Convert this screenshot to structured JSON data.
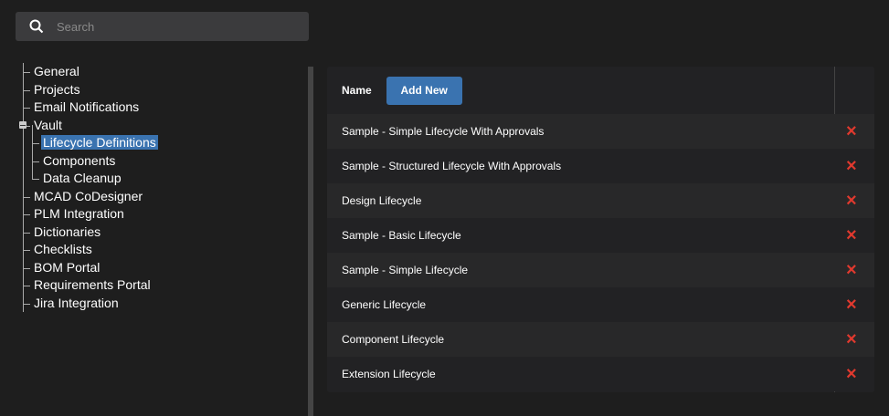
{
  "search": {
    "placeholder": "Search"
  },
  "tree": {
    "items": [
      {
        "label": "General",
        "level": 0
      },
      {
        "label": "Projects",
        "level": 0
      },
      {
        "label": "Email Notifications",
        "level": 0
      },
      {
        "label": "Vault",
        "level": 0,
        "expanded": true
      },
      {
        "label": "Lifecycle Definitions",
        "level": 1,
        "selected": true
      },
      {
        "label": "Components",
        "level": 1
      },
      {
        "label": "Data Cleanup",
        "level": 1
      },
      {
        "label": "MCAD CoDesigner",
        "level": 0
      },
      {
        "label": "PLM Integration",
        "level": 0
      },
      {
        "label": "Dictionaries",
        "level": 0
      },
      {
        "label": "Checklists",
        "level": 0
      },
      {
        "label": "BOM Portal",
        "level": 0
      },
      {
        "label": "Requirements Portal",
        "level": 0
      },
      {
        "label": "Jira Integration",
        "level": 0
      }
    ]
  },
  "table": {
    "name_header": "Name",
    "add_label": "Add New",
    "delete_icon": "×",
    "rows": [
      "Sample - Simple Lifecycle With Approvals",
      "Sample - Structured Lifecycle With Approvals",
      "Design Lifecycle",
      "Sample - Basic Lifecycle",
      "Sample - Simple Lifecycle",
      "Generic Lifecycle",
      "Component Lifecycle",
      "Extension Lifecycle"
    ]
  }
}
